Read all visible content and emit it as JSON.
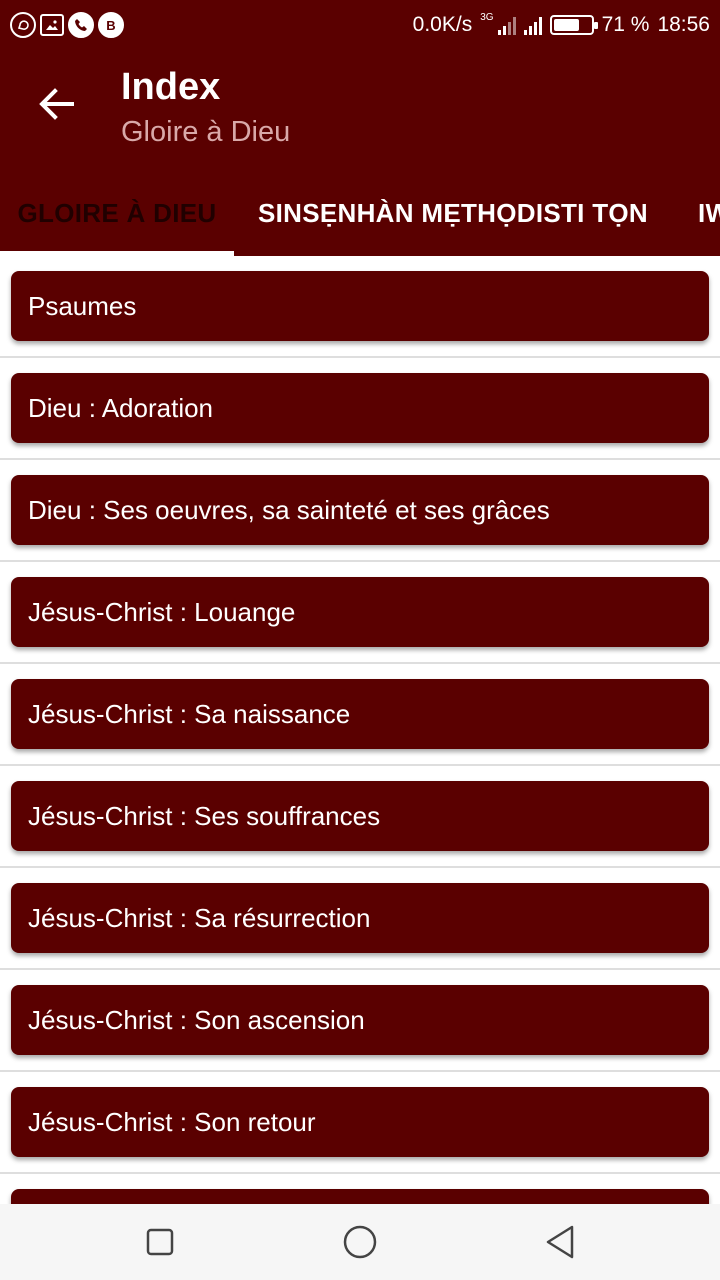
{
  "status_bar": {
    "net_speed": "0.0K/s",
    "network_type": "3G",
    "battery": "71 %",
    "battery_level": 0.71,
    "time": "18:56",
    "notification_icons": [
      "whatsapp-icon",
      "image-icon",
      "phone-icon",
      "b-app-icon"
    ]
  },
  "app_bar": {
    "title": "Index",
    "subtitle": "Gloire à Dieu",
    "back_icon": "arrow-left-icon"
  },
  "tabs": [
    {
      "label": "GLOIRE À DIEU",
      "selected": true
    },
    {
      "label": "SINSẸNHÀN MẸTHỌDISTI TỌN",
      "selected": false
    },
    {
      "label": "IW",
      "selected": false
    }
  ],
  "list": {
    "items": [
      "Psaumes",
      "Dieu : Adoration",
      "Dieu : Ses oeuvres, sa sainteté et ses grâces",
      "Jésus-Christ : Louange",
      "Jésus-Christ : Sa naissance",
      "Jésus-Christ : Ses souffrances",
      "Jésus-Christ : Sa résurrection",
      "Jésus-Christ : Son ascension",
      "Jésus-Christ : Son retour",
      ""
    ]
  },
  "nav_bar": {
    "icons": [
      "recent-apps-icon",
      "home-icon",
      "back-icon"
    ]
  },
  "colors": {
    "primary": "#5a0000",
    "tab_selected_text": "#200000",
    "subtitle": "#d9a9a9",
    "background": "#ffffff"
  }
}
